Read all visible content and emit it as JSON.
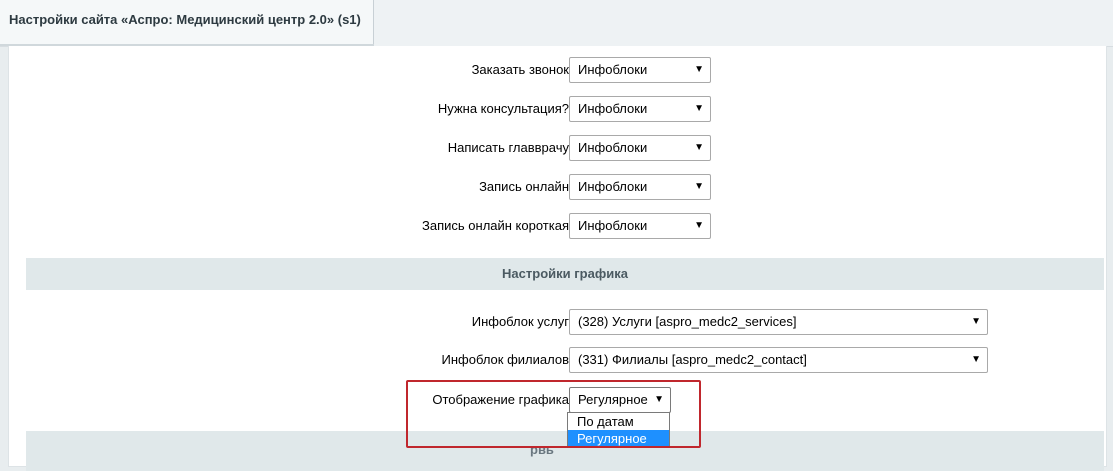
{
  "tab": {
    "title": "Настройки сайта «Аспро: Медицинский центр 2.0» (s1)"
  },
  "forms_rows": [
    {
      "label": "Заказать звонок",
      "value": "Инфоблоки"
    },
    {
      "label": "Нужна консультация?",
      "value": "Инфоблоки"
    },
    {
      "label": "Написать главврачу",
      "value": "Инфоблоки"
    },
    {
      "label": "Запись онлайн",
      "value": "Инфоблоки"
    },
    {
      "label": "Запись онлайн короткая",
      "value": "Инфоблоки"
    }
  ],
  "schedule_section": {
    "title": "Настройки графика",
    "services_label": "Инфоблок услуг",
    "services_value": "(328) Услуги [aspro_medc2_services]",
    "branches_label": "Инфоблок филиалов",
    "branches_value": "(331) Филиалы [aspro_medc2_contact]",
    "display_label": "Отображение графика",
    "display_value": "Регулярное",
    "display_options": [
      "По датам",
      "Регулярное"
    ],
    "display_selected_index": 1
  },
  "next_section": {
    "title_partial": "рвь"
  },
  "arrow_glyph": "▼",
  "colors": {
    "highlight": "#c0272d",
    "option_selected": "#1e90ff",
    "section_bg": "#e0e8ea"
  }
}
